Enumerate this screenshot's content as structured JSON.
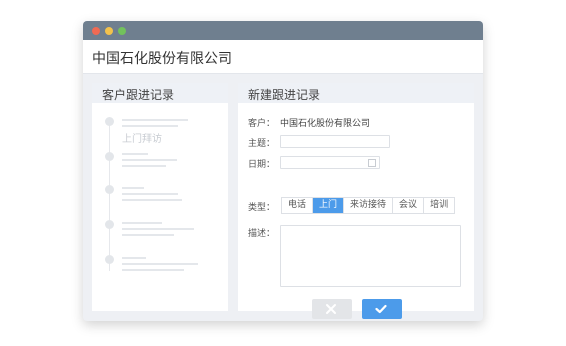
{
  "window": {
    "company_title": "中国石化股份有限公司"
  },
  "left_panel": {
    "title": "客户跟进记录",
    "timeline": [
      {
        "text": "上门拜访"
      },
      {
        "text": ""
      },
      {
        "text": ""
      },
      {
        "text": ""
      },
      {
        "text": ""
      }
    ]
  },
  "right_panel": {
    "title": "新建跟进记录",
    "customer_label": "客户：",
    "customer_value": "中国石化股份有限公司",
    "subject_label": "主题：",
    "subject_value": "",
    "date_label": "日期：",
    "date_value": "",
    "type_label": "类型：",
    "types": [
      "电话",
      "上门",
      "来访接待",
      "会议",
      "培训"
    ],
    "selected_type": "上门",
    "description_label": "描述：",
    "description_value": ""
  },
  "colors": {
    "titlebar": "#6f7f8f",
    "accent": "#4c9bea",
    "close_dot": "#ef6a53",
    "minimize_dot": "#f2c24c",
    "maximize_dot": "#72c25c"
  },
  "icons": {
    "cancel": "close-icon",
    "confirm": "check-icon",
    "date": "calendar-icon"
  }
}
